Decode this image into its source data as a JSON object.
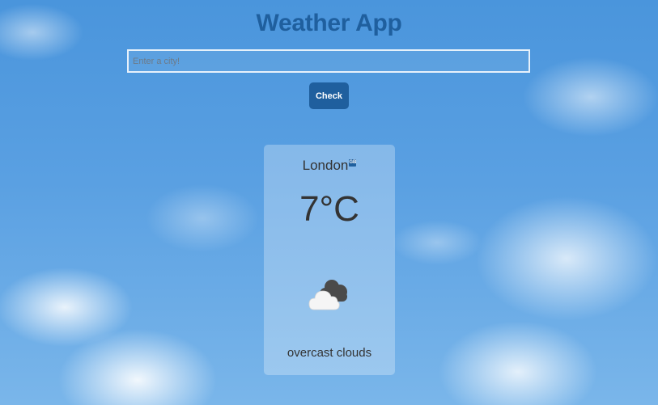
{
  "header": {
    "title": "Weather App"
  },
  "search": {
    "placeholder": "Enter a city!",
    "value": "",
    "button_label": "Check"
  },
  "weather": {
    "city": "London",
    "country_code": "GB",
    "temperature": "7°C",
    "description": "overcast clouds",
    "icon": "overcast-clouds-icon"
  },
  "colors": {
    "accent": "#1f5f9e",
    "text": "#333333",
    "card_background": "rgba(255,255,255,0.28)"
  }
}
